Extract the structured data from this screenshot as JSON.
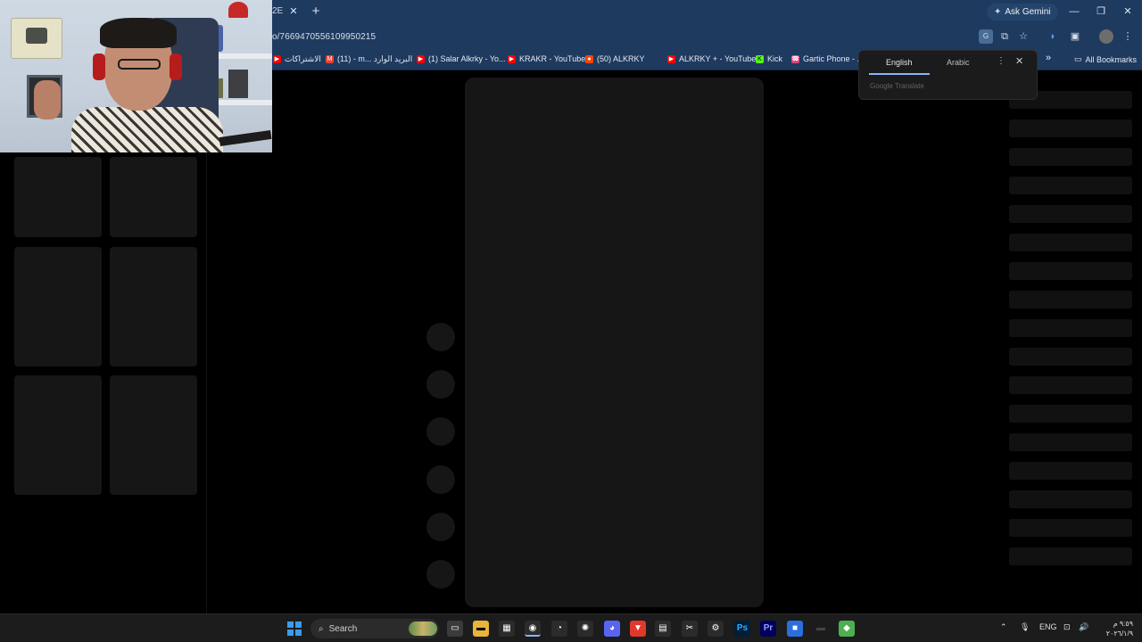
{
  "browser": {
    "tab_fragment": "2E",
    "tab_close_icon": "close-icon",
    "new_tab_symbol": "+",
    "ask_gemini": "Ask Gemini",
    "url": "o/7669470556109950215",
    "window_controls": [
      "—",
      "❐",
      "✕"
    ]
  },
  "bookmarks": [
    {
      "label": "الاشتراكات",
      "icon": "youtube-icon",
      "color": "#ff0000"
    },
    {
      "label": "(11) - m... البريد الوارد",
      "icon": "gmail-icon",
      "color": "#ea4335"
    },
    {
      "label": "(1) Salar Alkrky - Yo...",
      "icon": "youtube-icon",
      "color": "#ff0000"
    },
    {
      "label": "KRAKR - YouTube",
      "icon": "youtube-icon",
      "color": "#ff0000"
    },
    {
      "label": "(50) ALKRKY",
      "icon": "reddit-icon",
      "color": "#ff4500"
    },
    {
      "label": "ALKRKY + - YouTube",
      "icon": "youtube-icon",
      "color": "#ff0000"
    },
    {
      "label": "Kick",
      "icon": "kick-icon",
      "color": "#53fc18"
    },
    {
      "label": "Gartic Phone - ...",
      "icon": "gartic-icon",
      "color": "#e0457b"
    }
  ],
  "all_bookmarks": "All Bookmarks",
  "translate_popup": {
    "tab_source": "English",
    "tab_target": "Arabic",
    "brand": "Google Translate"
  },
  "taskbar": {
    "search_label": "Search",
    "language": "ENG",
    "time": "٩:٥٩ م",
    "date": "٢٠٢٦/١/٩"
  },
  "colors": {
    "browser_chrome": "#1f3a5f",
    "skeleton": "#161616",
    "accent_blue": "#8ab4f8"
  }
}
